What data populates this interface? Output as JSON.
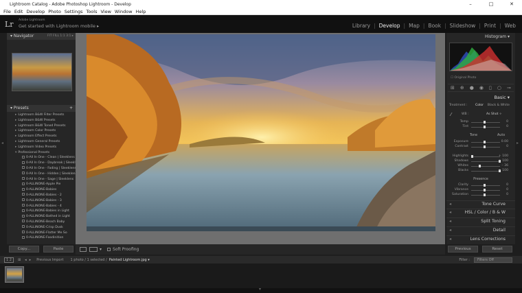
{
  "window": {
    "title": "Lightroom Catalog - Adobe Photoshop Lightroom - Develop",
    "controls": [
      "–",
      "□",
      "✕"
    ]
  },
  "menu": [
    "File",
    "Edit",
    "Develop",
    "Photo",
    "Settings",
    "Tools",
    "View",
    "Window",
    "Help"
  ],
  "identity": {
    "logo": "Lr",
    "line1": "Adobe Lightroom",
    "line2": "Get started with Lightroom mobile ▸"
  },
  "modules": [
    {
      "label": "Library",
      "active": false
    },
    {
      "label": "Develop",
      "active": true
    },
    {
      "label": "Map",
      "active": false
    },
    {
      "label": "Book",
      "active": false
    },
    {
      "label": "Slideshow",
      "active": false
    },
    {
      "label": "Print",
      "active": false
    },
    {
      "label": "Web",
      "active": false
    }
  ],
  "navigator": {
    "title": "Navigator",
    "zoom": "FIT  FILL  1:1  3:1 ▸"
  },
  "presets": {
    "title": "Presets",
    "add": "+",
    "folders": [
      "Lightroom B&W Filter Presets",
      "Lightroom B&W Presets",
      "Lightroom B&W Toned Presets",
      "Lightroom Color Presets",
      "Lightroom Effect Presets",
      "Lightroom General Presets",
      "Lightroom Video Presets",
      "Professional Presets"
    ],
    "items": [
      "0-All In One - Clean | Sleeklens",
      "0-All In One - Daybreak | Sleekl...",
      "0-All In One - Fading | Sleeklens",
      "0-All In One - Hidden | Sleeklens",
      "0-All In One - Sage | Sleeklens",
      "0-ALLINONE-Apple Pie",
      "0-ALLINONE-Babies",
      "0-ALLINONE-Babies - 2",
      "0-ALLINONE-Babies - 3",
      "0-ALLINONE-Babies - 4",
      "0-ALLINONE-Babies in Light",
      "0-ALLINONE-Bathed in Light",
      "0-ALLINONE-Beach Baby",
      "0-ALLINONE-Crisp Dusk",
      "0-ALLINONE-Flatter Me So",
      "0-ALLINONE-Foodinition"
    ]
  },
  "left_buttons": {
    "copy": "Copy...",
    "paste": "Paste"
  },
  "toolbar": {
    "soft_proofing": "Soft Proofing"
  },
  "right": {
    "histogram": "Histogram",
    "original_photo": "☐ Original Photo",
    "basic": "Basic",
    "treatment_label": "Treatment :",
    "treatment_color": "Color",
    "treatment_bw": "Black & White",
    "wb_label": "WB :",
    "wb_value": "As Shot ÷",
    "temp": {
      "label": "Temp",
      "value": "0"
    },
    "tint": {
      "label": "Tint",
      "value": "0"
    },
    "tone": "Tone",
    "auto": "Auto",
    "exposure": {
      "label": "Exposure",
      "value": "0.00"
    },
    "contrast": {
      "label": "Contrast",
      "value": "0"
    },
    "highlights": {
      "label": "Highlights",
      "value": "+ 100"
    },
    "shadows": {
      "label": "Shadows",
      "value": "+ 100"
    },
    "whites": {
      "label": "Whites",
      "value": "– 36"
    },
    "blacks": {
      "label": "Blacks",
      "value": "+ 100"
    },
    "presence": "Presence",
    "clarity": {
      "label": "Clarity",
      "value": "0"
    },
    "vibrance": {
      "label": "Vibrance",
      "value": "0"
    },
    "saturation": {
      "label": "Saturation",
      "value": "0"
    },
    "tone_curve": "Tone Curve",
    "hsl": "HSL  /  Color  /  B & W",
    "split_toning": "Split Toning",
    "detail": "Detail",
    "lens": "Lens Corrections",
    "previous": "Previous",
    "reset": "Reset"
  },
  "filmstrip": {
    "nums": "1  2",
    "import": "Previous Import",
    "count": "1 photo / 1 selected /",
    "file": "Painted Lightroom.jpg ▾",
    "filter_label": "Filter :",
    "filter_value": "Filters Off"
  }
}
